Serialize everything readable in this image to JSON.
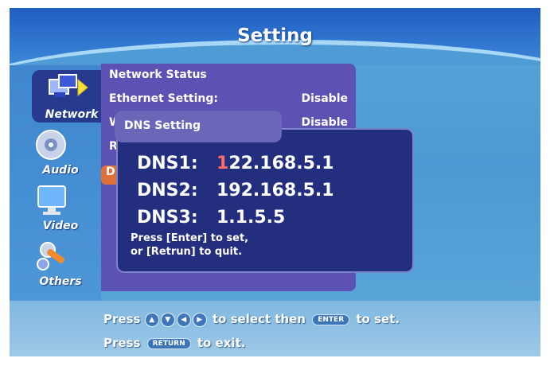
{
  "header": {
    "title": "Setting"
  },
  "sidebar": {
    "items": [
      {
        "label": "Network",
        "icon": "network-icon"
      },
      {
        "label": "Audio",
        "icon": "audio-icon"
      },
      {
        "label": "Video",
        "icon": "video-icon"
      },
      {
        "label": "Others",
        "icon": "others-icon"
      }
    ]
  },
  "menu": {
    "items": [
      {
        "label": "Network Status",
        "value": ""
      },
      {
        "label": "Ethernet Setting:",
        "value": "Disable"
      },
      {
        "label": "W",
        "value": "Disable"
      },
      {
        "label": "Re",
        "value": ""
      },
      {
        "label": "D",
        "value": ""
      }
    ]
  },
  "dialog": {
    "title": "DNS Setting",
    "entries": [
      {
        "key": "DNS1:",
        "cursor_char": "1",
        "value_rest": "22.168.5.1"
      },
      {
        "key": "DNS2:",
        "value": "192.168.5.1"
      },
      {
        "key": "DNS3:",
        "value": "1.1.5.5"
      }
    ],
    "hint_line1": "Press [Enter] to set,",
    "hint_line2": "or [Retrun] to quit."
  },
  "footer": {
    "line1_prefix": "Press",
    "line1_middle": "to select then",
    "line1_enter": "ENTER",
    "line1_suffix": "to set.",
    "line2_prefix": "Press",
    "line2_return": "RETURN",
    "line2_suffix": "to exit.",
    "arrows": [
      "▲",
      "▼",
      "◀",
      "▶"
    ]
  },
  "colors": {
    "accent_cursor": "#ff6a6a",
    "dialog_bg": "#232e7e",
    "panel_bg": "#5b52b4",
    "selected_item": "#e0703a"
  }
}
